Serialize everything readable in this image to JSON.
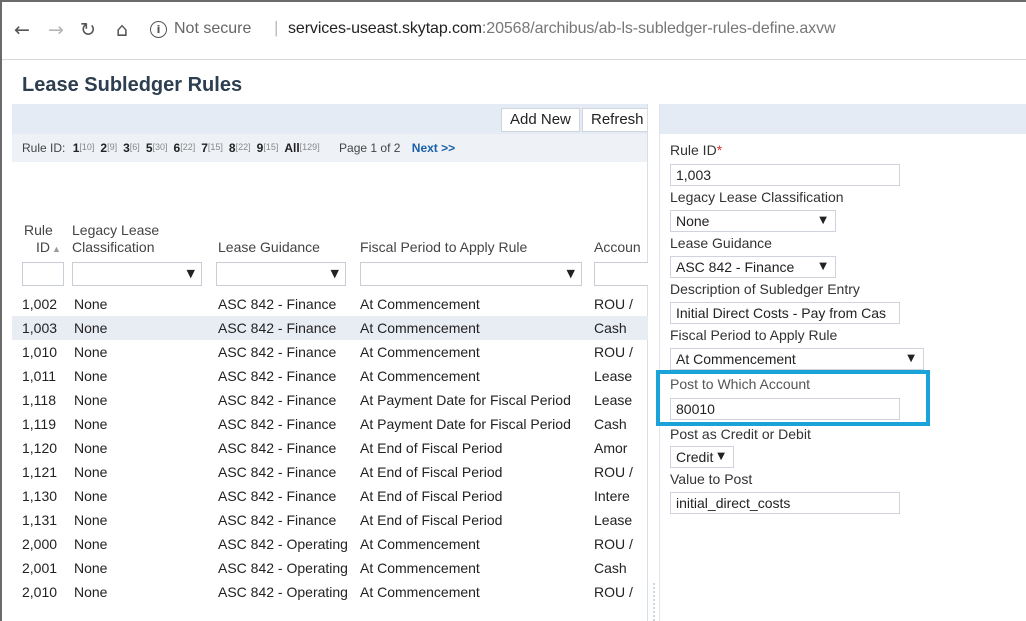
{
  "browser": {
    "security_label": "Not secure",
    "url_host": "services-useast.skytap.com",
    "url_path": ":20568/archibus/ab-ls-subledger-rules-define.axvw",
    "icons": [
      "back-arrow-icon",
      "forward-arrow-icon",
      "reload-icon",
      "home-icon",
      "info-icon"
    ]
  },
  "app": {
    "title": "Lease Subledger Rules"
  },
  "toolbar": {
    "add_new": "Add New",
    "refresh": "Refresh"
  },
  "index": {
    "label": "Rule ID:",
    "entries": [
      {
        "key": "1",
        "count": "[10]"
      },
      {
        "key": "2",
        "count": "[9]"
      },
      {
        "key": "3",
        "count": "[6]"
      },
      {
        "key": "5",
        "count": "[30]"
      },
      {
        "key": "6",
        "count": "[22]"
      },
      {
        "key": "7",
        "count": "[15]"
      },
      {
        "key": "8",
        "count": "[22]"
      },
      {
        "key": "9",
        "count": "[15]"
      },
      {
        "key": "All",
        "count": "[129]"
      }
    ],
    "page_info": "Page 1 of 2",
    "next": "Next >>"
  },
  "grid": {
    "headers": {
      "rule_id_line1": "Rule",
      "rule_id_line2": "ID",
      "sort_icon": "sort-ascending-icon",
      "classification_line1": "Legacy Lease",
      "classification_line2": "Classification",
      "guidance": "Lease Guidance",
      "fiscal": "Fiscal Period to Apply Rule",
      "account": "Accoun"
    },
    "rows": [
      {
        "id": "1,002",
        "classification": "None",
        "guidance": "ASC 842 - Finance",
        "fiscal": "At Commencement",
        "account": "ROU /"
      },
      {
        "id": "1,003",
        "classification": "None",
        "guidance": "ASC 842 - Finance",
        "fiscal": "At Commencement",
        "account": "Cash"
      },
      {
        "id": "1,010",
        "classification": "None",
        "guidance": "ASC 842 - Finance",
        "fiscal": "At Commencement",
        "account": "ROU /"
      },
      {
        "id": "1,011",
        "classification": "None",
        "guidance": "ASC 842 - Finance",
        "fiscal": "At Commencement",
        "account": "Lease"
      },
      {
        "id": "1,118",
        "classification": "None",
        "guidance": "ASC 842 - Finance",
        "fiscal": "At Payment Date for Fiscal Period",
        "account": "Lease"
      },
      {
        "id": "1,119",
        "classification": "None",
        "guidance": "ASC 842 - Finance",
        "fiscal": "At Payment Date for Fiscal Period",
        "account": "Cash"
      },
      {
        "id": "1,120",
        "classification": "None",
        "guidance": "ASC 842 - Finance",
        "fiscal": "At End of Fiscal Period",
        "account": "Amor"
      },
      {
        "id": "1,121",
        "classification": "None",
        "guidance": "ASC 842 - Finance",
        "fiscal": "At End of Fiscal Period",
        "account": "ROU /"
      },
      {
        "id": "1,130",
        "classification": "None",
        "guidance": "ASC 842 - Finance",
        "fiscal": "At End of Fiscal Period",
        "account": "Intere"
      },
      {
        "id": "1,131",
        "classification": "None",
        "guidance": "ASC 842 - Finance",
        "fiscal": "At End of Fiscal Period",
        "account": "Lease"
      },
      {
        "id": "2,000",
        "classification": "None",
        "guidance": "ASC 842 - Operating",
        "fiscal": "At Commencement",
        "account": "ROU /"
      },
      {
        "id": "2,001",
        "classification": "None",
        "guidance": "ASC 842 - Operating",
        "fiscal": "At Commencement",
        "account": "Cash"
      },
      {
        "id": "2,010",
        "classification": "None",
        "guidance": "ASC 842 - Operating",
        "fiscal": "At Commencement",
        "account": "ROU /"
      }
    ],
    "selected_row_id": "1,003"
  },
  "form": {
    "rule_id_label": "Rule ID",
    "rule_id_value": "1,003",
    "classification_label": "Legacy Lease Classification",
    "classification_value": "None",
    "guidance_label": "Lease Guidance",
    "guidance_value": "ASC 842 - Finance",
    "description_label": "Description of Subledger Entry",
    "description_value": "Initial Direct Costs - Pay from Cas",
    "fiscal_label": "Fiscal Period to Apply Rule",
    "fiscal_value": "At Commencement",
    "account_label": "Post to Which Account",
    "account_value": "80010",
    "credit_debit_label": "Post as Credit or Debit",
    "credit_debit_value": "Credit",
    "value_label": "Value to Post",
    "value_value": "initial_direct_costs"
  },
  "colors": {
    "accent_highlight": "#1aa3d9",
    "panel_header": "#e4ebf5",
    "title": "#2c3e50",
    "link": "#1a5fa8"
  }
}
